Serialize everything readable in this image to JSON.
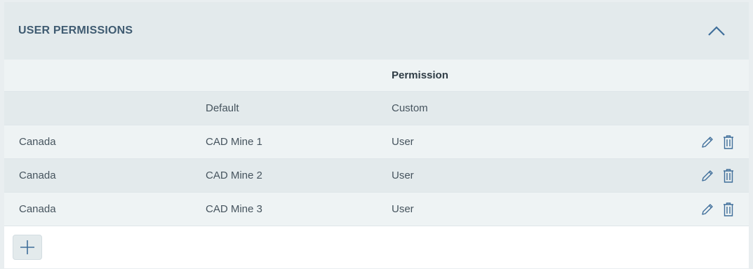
{
  "panel": {
    "title": "USER PERMISSIONS"
  },
  "table": {
    "group_header": "Permission",
    "sub_headers": [
      "",
      "Default",
      "Custom"
    ],
    "rows": [
      {
        "region": "Canada",
        "default": "CAD Mine 1",
        "custom": "User"
      },
      {
        "region": "Canada",
        "default": "CAD Mine 2",
        "custom": "User"
      },
      {
        "region": "Canada",
        "default": "CAD Mine 3",
        "custom": "User"
      }
    ]
  },
  "icons": {
    "collapse": "chevron-up-icon",
    "edit": "pencil-icon",
    "delete": "trash-icon",
    "add": "plus-icon"
  },
  "colors": {
    "accent": "#3f6e9a",
    "header_bg": "#e3eaec",
    "row_alt_bg": "#eef3f4"
  }
}
